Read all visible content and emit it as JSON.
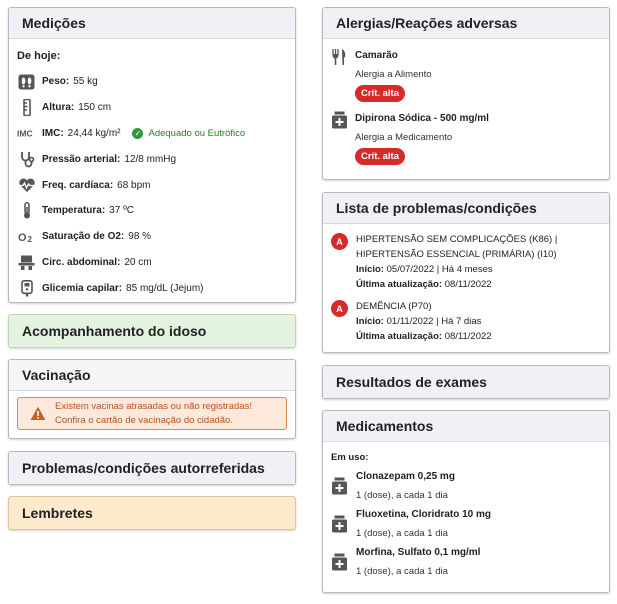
{
  "medicoes": {
    "title": "Medições",
    "section_label": "De hoje:",
    "vitals": [
      {
        "icon": "footprints-icon",
        "label": "Peso:",
        "value": "55 kg"
      },
      {
        "icon": "ruler-icon",
        "label": "Altura:",
        "value": "150 cm"
      },
      {
        "icon": "imc-icon",
        "label": "IMC:",
        "value": "24,44 kg/m²",
        "status": "Adequado ou Eutrófico"
      },
      {
        "icon": "stethoscope-icon",
        "label": "Pressão arterial:",
        "value": "12/8 mmHg"
      },
      {
        "icon": "heart-pulse-icon",
        "label": "Freq. cardíaca:",
        "value": "68 bpm"
      },
      {
        "icon": "thermometer-icon",
        "label": "Temperatura:",
        "value": "37 ºC"
      },
      {
        "icon": "o2-icon",
        "label": "Saturação de O2:",
        "value": "98 %"
      },
      {
        "icon": "waist-icon",
        "label": "Circ. abdominal:",
        "value": "20 cm"
      },
      {
        "icon": "glucometer-icon",
        "label": "Glicemia capilar:",
        "value": "85 mg/dL (Jejum)"
      }
    ]
  },
  "acompanhamento": {
    "title": "Acompanhamento do idoso"
  },
  "vacinacao": {
    "title": "Vacinação",
    "warning_line1": "Existem vacinas atrasadas ou não registradas!",
    "warning_line2": "Confira o cartão de vacinação do cidadão."
  },
  "problemas_auto": {
    "title": "Problemas/condições autorreferidas"
  },
  "lembretes": {
    "title": "Lembretes"
  },
  "alergias": {
    "title": "Alergias/Reações adversas",
    "items": [
      {
        "icon": "cutlery-icon",
        "name": "Camarão",
        "type": "Alergia a Alimento",
        "badge": "Crít. alta"
      },
      {
        "icon": "medicine-box-icon",
        "name": "Dipirona Sódica - 500 mg/ml",
        "type": "Alergia a Medicamento",
        "badge": "Crít. alta"
      }
    ]
  },
  "lista_problemas": {
    "title": "Lista de problemas/condições",
    "items": [
      {
        "marker": "A",
        "name_line1": "HIPERTENSÃO SEM COMPLICAÇÕES (K86) |",
        "name_line2": "HIPERTENSÃO ESSENCIAL (PRIMÁRIA) (I10)",
        "inicio_label": "Início:",
        "inicio_value": "05/07/2022 | Há 4 meses",
        "atualizacao_label": "Última atualização:",
        "atualizacao_value": "08/11/2022"
      },
      {
        "marker": "A",
        "name_line1": "DEMÊNCIA (P70)",
        "inicio_label": "Início:",
        "inicio_value": "01/11/2022 | Há 7 dias",
        "atualizacao_label": "Última atualização:",
        "atualizacao_value": "08/11/2022"
      }
    ]
  },
  "resultados": {
    "title": "Resultados de exames"
  },
  "medicamentos": {
    "title": "Medicamentos",
    "section_label": "Em uso:",
    "items": [
      {
        "name": "Clonazepam 0,25 mg",
        "dose": "1 (dose), a cada 1 dia"
      },
      {
        "name": "Fluoxetina, Cloridrato 10 mg",
        "dose": "1 (dose), a cada 1 dia"
      },
      {
        "name": "Morfina, Sulfato 0,1 mg/ml",
        "dose": "1 (dose), a cada 1 dia"
      }
    ]
  },
  "colors": {
    "critical": "#d52b2b",
    "ok": "#2f9a3a",
    "warning": "#b5531d"
  }
}
